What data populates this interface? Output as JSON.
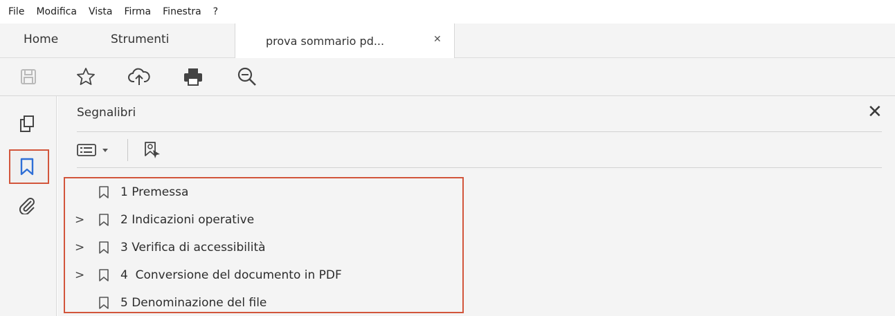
{
  "menu": [
    "File",
    "Modifica",
    "Vista",
    "Firma",
    "Finestra",
    "?"
  ],
  "tabs": {
    "home": "Home",
    "tools": "Strumenti",
    "document": "prova sommario pd...",
    "close_glyph": "✕"
  },
  "toolbar": {
    "icons": [
      "save-icon",
      "star-icon",
      "cloud-upload-icon",
      "print-icon",
      "zoom-out-icon"
    ]
  },
  "rail": {
    "icons": [
      "pages-icon",
      "bookmark-icon",
      "attachment-icon"
    ],
    "selected": "bookmark-icon"
  },
  "panel": {
    "title": "Segnalibri",
    "close_glyph": "✕",
    "bookmarks": [
      {
        "label": "1 Premessa",
        "expandable": false
      },
      {
        "label": "2 Indicazioni operative",
        "expandable": true
      },
      {
        "label": "3 Verifica di accessibilità",
        "expandable": true
      },
      {
        "label": "4  Conversione del documento in PDF",
        "expandable": true
      },
      {
        "label": "5 Denominazione del file",
        "expandable": false
      }
    ]
  },
  "colors": {
    "highlight": "#d2553b",
    "accent_blue": "#2f6fd6"
  }
}
